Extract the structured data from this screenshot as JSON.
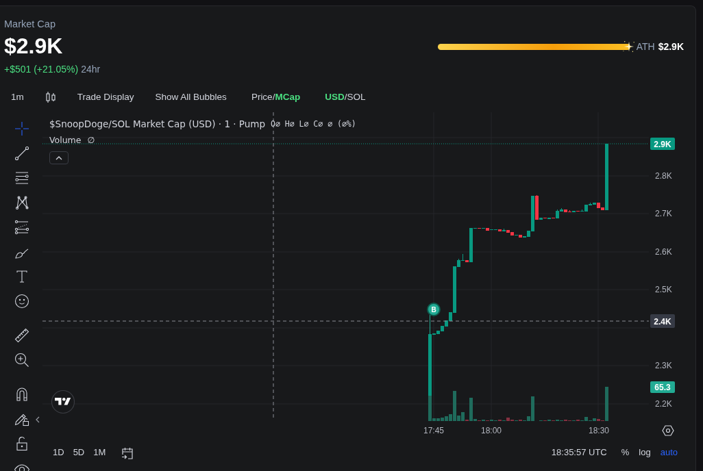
{
  "header": {
    "label": "Market Cap",
    "value": "$2.9K",
    "change": "+$501 (+21.05%)",
    "period": "24hr"
  },
  "ath": {
    "level": 1,
    "label": "ATH",
    "value": "$2.9K"
  },
  "toolbar": {
    "interval": "1m",
    "items": [
      "Trade Display",
      "Show All Bubbles"
    ],
    "value_toggle": {
      "options": [
        {
          "label": "Price",
          "selected": false
        },
        {
          "label": "MCap",
          "selected": true
        }
      ],
      "separator": "/"
    },
    "currency_toggle": {
      "options": [
        {
          "label": "USD",
          "selected": true
        },
        {
          "label": "SOL",
          "selected": false
        }
      ],
      "separator": "/"
    }
  },
  "drawing_tools": [
    {
      "selected": true
    },
    {
      "selected": false
    },
    {
      "selected": false
    },
    {
      "selected": false
    },
    {
      "selected": false
    },
    {
      "selected": false
    },
    {
      "selected": false
    },
    {
      "selected": false
    },
    {
      "selected": false
    },
    {
      "selected": false
    },
    {
      "selected": false
    },
    {
      "selected": false
    },
    {
      "selected": false
    },
    {
      "selected": false
    }
  ],
  "chart": {
    "legend": {
      "title": "$SnoopDoge/SOL Market Cap (USD) · 1 · Pump",
      "ohlc": "O∅ H∅ L∅ C∅ ∅ (∅%)",
      "volume_label": "Volume",
      "volume_value": "∅"
    },
    "price_axis": [
      "2.8K",
      "2.7K",
      "2.6K",
      "2.5K",
      "2.3K",
      "2.2K"
    ],
    "time_axis": [
      "17:45",
      "18:00",
      "18:30"
    ],
    "last_price_badge": "2.9K",
    "crosshair_badge": "2.4K",
    "volume_badge": "65.3",
    "trade_marker": "B"
  },
  "bottom_bar": {
    "ranges": [
      "1D",
      "5D",
      "1M"
    ],
    "clock": "18:35:57 UTC",
    "scale_options": [
      {
        "label": "%",
        "selected": false
      },
      {
        "label": "log",
        "selected": false
      },
      {
        "label": "auto",
        "selected": true
      }
    ]
  }
}
